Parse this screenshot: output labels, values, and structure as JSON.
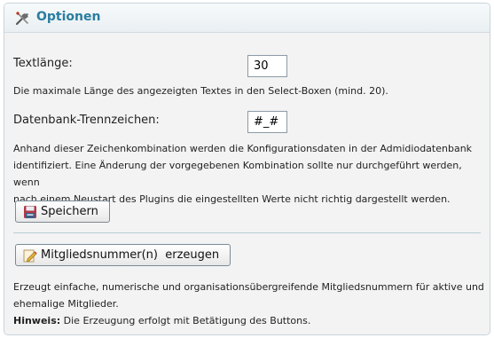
{
  "panel": {
    "title": "Optionen",
    "header_icon": "tools-icon"
  },
  "text_length": {
    "label": "Textlänge:",
    "value": "30",
    "help": "Die maximale Länge des angezeigten Textes in den Select-Boxen (mind. 20)."
  },
  "separator": {
    "label": "Datenbank-Trennzeichen:",
    "value": "#_#",
    "help_line1": "Anhand dieser Zeichenkombination werden die Konfigurationsdaten in der Admidiodatenbank",
    "help_line2": "identifiziert. Eine Änderung der vorgegebenen Kombination sollte nur durchgeführt werden, wenn",
    "help_line3": "nach einem Neustart des Plugins die eingestellten Werte nicht richtig dargestellt werden."
  },
  "save_button": {
    "label": "Speichern",
    "icon": "floppy-disk-icon"
  },
  "generate_button": {
    "label": "Mitgliedsnummer(n)  erzeugen",
    "icon": "pencil-edit-icon"
  },
  "generate_info": {
    "line1": "Erzeugt einfache, numerische und organisationsübergreifende Mitgliedsnummern für aktive und",
    "line2": "ehemalige Mitglieder.",
    "hint_label": "Hinweis:",
    "hint_text": " Die Erzeugung erfolgt mit Betätigung des Buttons."
  }
}
